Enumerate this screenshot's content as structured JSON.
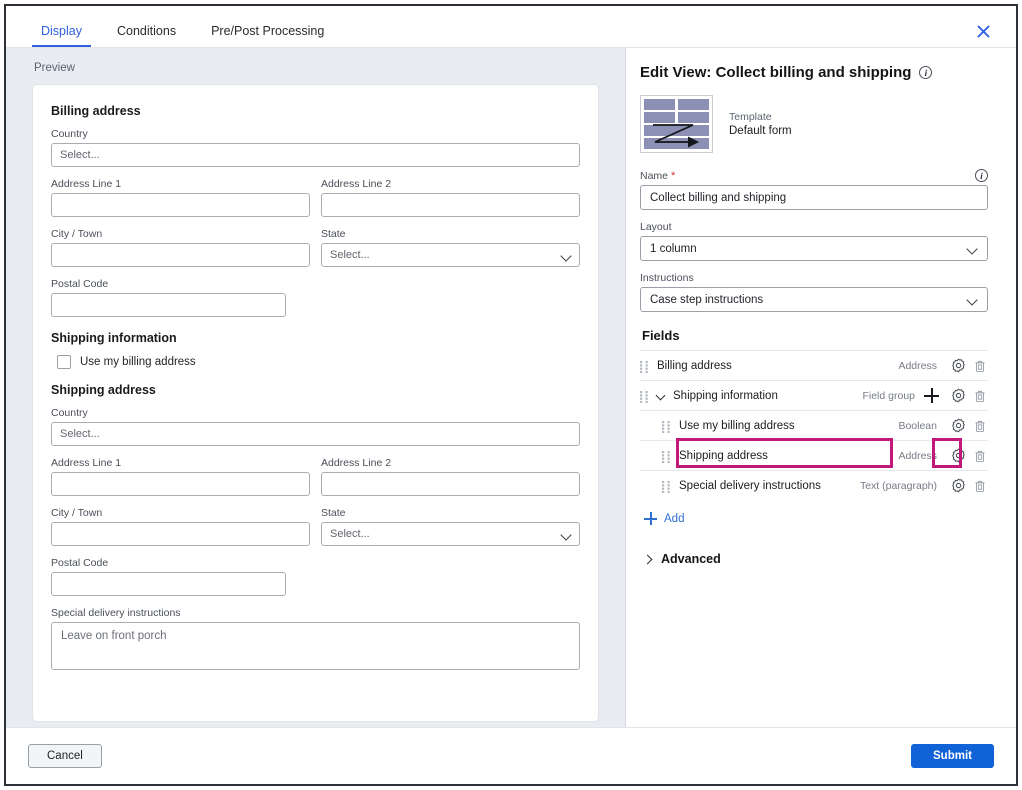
{
  "tabs": [
    {
      "label": "Display",
      "active": true
    },
    {
      "label": "Conditions",
      "active": false
    },
    {
      "label": "Pre/Post Processing",
      "active": false
    }
  ],
  "close_icon": "close-icon",
  "colors": {
    "accent_blue": "#2f5fe0",
    "link_blue": "#2f6fd0",
    "submit_blue": "#1162d6",
    "highlight_magenta": "#c2187b",
    "required_red": "#d0342c",
    "template_bar": "#8b90b4",
    "left_bg": "#e9edf2"
  },
  "preview": {
    "label": "Preview",
    "billing": {
      "heading": "Billing address",
      "country_label": "Country",
      "country_value": "Select...",
      "address1_label": "Address Line 1",
      "address1_value": "",
      "address2_label": "Address Line 2",
      "address2_value": "",
      "city_label": "City / Town",
      "city_value": "",
      "state_label": "State",
      "state_value": "Select...",
      "postal_label": "Postal Code",
      "postal_value": ""
    },
    "shipping_info": {
      "heading": "Shipping information",
      "checkbox_label": "Use my billing address",
      "checked": false
    },
    "shipping": {
      "heading": "Shipping address",
      "country_label": "Country",
      "country_value": "Select...",
      "address1_label": "Address Line 1",
      "address1_value": "",
      "address2_label": "Address Line 2",
      "address2_value": "",
      "city_label": "City / Town",
      "city_value": "",
      "state_label": "State",
      "state_value": "Select...",
      "postal_label": "Postal Code",
      "postal_value": ""
    },
    "special": {
      "label": "Special delivery instructions",
      "placeholder": "Leave on front porch"
    }
  },
  "editor": {
    "title": "Edit View: Collect billing and shipping",
    "title_info_icon": "info-icon",
    "template": {
      "thumb_icon": "template-thumbnail-icon",
      "key": "Template",
      "value": "Default form"
    },
    "name": {
      "label": "Name",
      "required_mark": "*",
      "info_icon": "info-icon",
      "value": "Collect billing and shipping"
    },
    "layout": {
      "label": "Layout",
      "value": "1 column"
    },
    "instructions": {
      "label": "Instructions",
      "value": "Case step instructions"
    },
    "fields_heading": "Fields",
    "fields": [
      {
        "name": "Billing address",
        "type": "Address",
        "indent": false,
        "chevron": false,
        "has_plus": false,
        "highlighted": false
      },
      {
        "name": "Shipping information",
        "type": "Field group",
        "indent": false,
        "chevron": true,
        "has_plus": true,
        "highlighted": false
      },
      {
        "name": "Use my billing address",
        "type": "Boolean",
        "indent": true,
        "chevron": false,
        "has_plus": false,
        "highlighted": false
      },
      {
        "name": "Shipping address",
        "type": "Address",
        "indent": true,
        "chevron": false,
        "has_plus": false,
        "highlighted": true
      },
      {
        "name": "Special delivery instructions",
        "type": "Text (paragraph)",
        "indent": true,
        "chevron": false,
        "has_plus": false,
        "highlighted": false
      }
    ],
    "add_label": "Add",
    "advanced_label": "Advanced"
  },
  "footer": {
    "cancel_label": "Cancel",
    "submit_label": "Submit"
  }
}
